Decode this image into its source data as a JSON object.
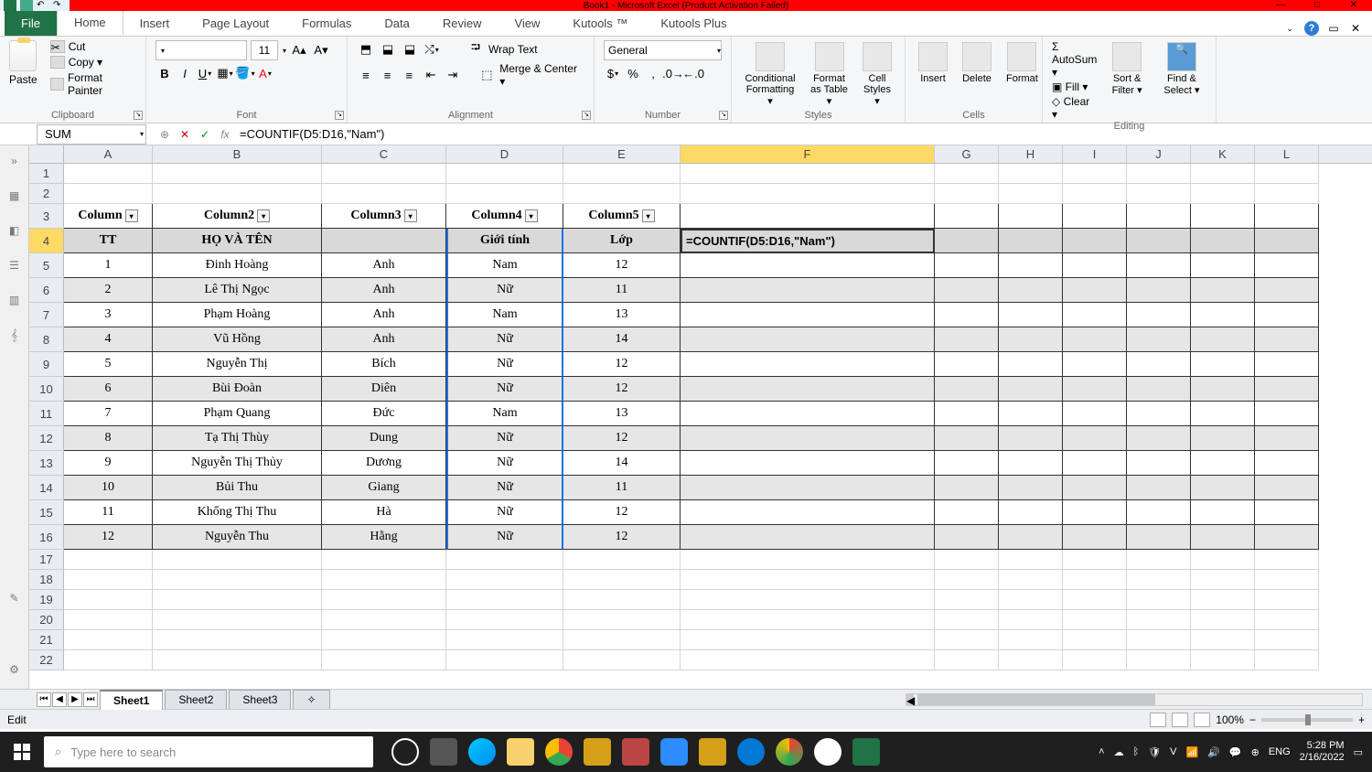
{
  "title": "Book1 - Microsoft Excel (Product Activation Failed)",
  "tabs": {
    "file": "File",
    "home": "Home",
    "insert": "Insert",
    "page": "Page Layout",
    "formulas": "Formulas",
    "data": "Data",
    "review": "Review",
    "view": "View",
    "kutools": "Kutools ™",
    "kutoolsplus": "Kutools Plus"
  },
  "ribbon": {
    "clipboard": {
      "label": "Clipboard",
      "paste": "Paste",
      "cut": "Cut",
      "copy": "Copy ▾",
      "painter": "Format Painter"
    },
    "font": {
      "label": "Font",
      "name": "",
      "size": "11"
    },
    "alignment": {
      "label": "Alignment",
      "wrap": "Wrap Text",
      "merge": "Merge & Center ▾"
    },
    "number": {
      "label": "Number",
      "general": "General"
    },
    "styles": {
      "label": "Styles",
      "cond": "Conditional Formatting ▾",
      "fat": "Format as Table ▾",
      "cell": "Cell Styles ▾"
    },
    "cells": {
      "label": "Cells",
      "insert": "Insert",
      "delete": "Delete",
      "format": "Format"
    },
    "editing": {
      "label": "Editing",
      "autosum": "AutoSum ▾",
      "fill": "Fill ▾",
      "clear": "Clear ▾",
      "sort": "Sort & Filter ▾",
      "find": "Find & Select ▾"
    }
  },
  "namebox": "SUM",
  "formula": "=COUNTIF(D5:D16,\"Nam\")",
  "edit_formula": "=COUNTIF(D5:D16,\"Nam\")",
  "cols": [
    "A",
    "B",
    "C",
    "D",
    "E",
    "F",
    "G",
    "H",
    "I",
    "J",
    "K",
    "L"
  ],
  "row_nums": [
    1,
    2,
    3,
    4,
    5,
    6,
    7,
    8,
    9,
    10,
    11,
    12,
    13,
    14,
    15,
    16,
    17,
    18,
    19,
    20,
    21,
    22
  ],
  "header_row": {
    "c1": "Column",
    "c2": "Column2",
    "c3": "Column3",
    "c4": "Column4",
    "c5": "Column5"
  },
  "header2": {
    "a": "TT",
    "b": "HỌ VÀ TÊN",
    "c": "",
    "d": "Giới tính",
    "e": "Lớp"
  },
  "data": [
    {
      "tt": "1",
      "ho": "Đinh Hoàng",
      "ten": "Anh",
      "gt": "Nam",
      "lop": "12"
    },
    {
      "tt": "2",
      "ho": "Lê Thị Ngọc",
      "ten": "Anh",
      "gt": "Nữ",
      "lop": "11"
    },
    {
      "tt": "3",
      "ho": "Phạm Hoàng",
      "ten": "Anh",
      "gt": "Nam",
      "lop": "13"
    },
    {
      "tt": "4",
      "ho": "Vũ Hồng",
      "ten": "Anh",
      "gt": "Nữ",
      "lop": "14"
    },
    {
      "tt": "5",
      "ho": "Nguyễn Thị",
      "ten": "Bích",
      "gt": "Nữ",
      "lop": "12"
    },
    {
      "tt": "6",
      "ho": "Bùi Đoàn",
      "ten": "Diên",
      "gt": "Nữ",
      "lop": "12"
    },
    {
      "tt": "7",
      "ho": "Phạm Quang",
      "ten": "Đức",
      "gt": "Nam",
      "lop": "13"
    },
    {
      "tt": "8",
      "ho": "Tạ Thị Thùy",
      "ten": "Dung",
      "gt": "Nữ",
      "lop": "12"
    },
    {
      "tt": "9",
      "ho": "Nguyễn Thị Thủy",
      "ten": "Dương",
      "gt": "Nữ",
      "lop": "14"
    },
    {
      "tt": "10",
      "ho": "Bủi Thu",
      "ten": "Giang",
      "gt": "Nữ",
      "lop": "11"
    },
    {
      "tt": "11",
      "ho": "Khổng Thị Thu",
      "ten": "Hà",
      "gt": "Nữ",
      "lop": "12"
    },
    {
      "tt": "12",
      "ho": "Nguyễn Thu",
      "ten": "Hằng",
      "gt": "Nữ",
      "lop": "12"
    }
  ],
  "sheets": {
    "s1": "Sheet1",
    "s2": "Sheet2",
    "s3": "Sheet3"
  },
  "status": "Edit",
  "zoom": "100%",
  "search_placeholder": "Type here to search",
  "tray": {
    "lang": "ENG",
    "time": "5:28 PM",
    "date": "2/16/2022"
  }
}
